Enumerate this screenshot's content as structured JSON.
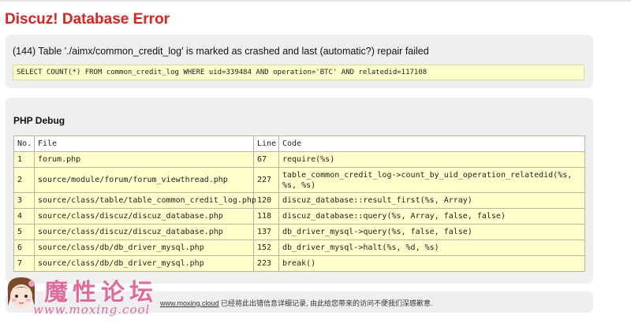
{
  "page": {
    "title": "Discuz! Database Error"
  },
  "error": {
    "message": "(144) Table './aimx/common_credit_log' is marked as crashed and last (automatic?) repair failed",
    "sql": "SELECT COUNT(*) FROM common_credit_log WHERE uid=339484 AND operation='BTC' AND relatedid=117108"
  },
  "debug": {
    "title": "PHP Debug",
    "headers": {
      "no": "No.",
      "file": "File",
      "line": "Line",
      "code": "Code"
    },
    "rows": [
      {
        "no": "1",
        "file": "forum.php",
        "line": "67",
        "code": "require(%s)"
      },
      {
        "no": "2",
        "file": "source/module/forum/forum_viewthread.php",
        "line": "227",
        "code": "table_common_credit_log->count_by_uid_operation_relatedid(%s, %s, %s)"
      },
      {
        "no": "3",
        "file": "source/class/table/table_common_credit_log.php",
        "line": "120",
        "code": "discuz_database::result_first(%s, Array)"
      },
      {
        "no": "4",
        "file": "source/class/discuz/discuz_database.php",
        "line": "118",
        "code": "discuz_database::query(%s, Array, false, false)"
      },
      {
        "no": "5",
        "file": "source/class/discuz/discuz_database.php",
        "line": "137",
        "code": "db_driver_mysql->query(%s, false, false)"
      },
      {
        "no": "6",
        "file": "source/class/db/db_driver_mysql.php",
        "line": "152",
        "code": "db_driver_mysql->halt(%s, %d, %s)"
      },
      {
        "no": "7",
        "file": "source/class/db/db_driver_mysql.php",
        "line": "223",
        "code": "break()"
      }
    ]
  },
  "footer": {
    "link": "www.moxing.cloud",
    "text": " 已经将此出错信息详细记录, 由此给您带来的访问不便我们深感歉意."
  },
  "watermark": {
    "cn": "魔性论坛",
    "url": "www.moxing.cool"
  },
  "colors": {
    "title": "#e32020",
    "panel": "#efefef",
    "highlight": "#ffffcc",
    "watermark": "#e06a9a"
  }
}
